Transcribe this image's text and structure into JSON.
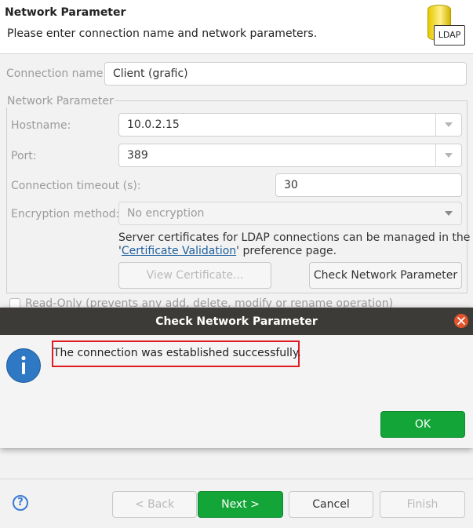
{
  "header": {
    "title": "Network Parameter",
    "subtitle": "Please enter connection name and network parameters.",
    "logo_text": "LDAP"
  },
  "connection_name": {
    "label": "Connection name:",
    "value": "Client (grafic)"
  },
  "network_group": {
    "legend": "Network Parameter",
    "hostname": {
      "label": "Hostname:",
      "value": "10.0.2.15"
    },
    "port": {
      "label": "Port:",
      "value": "389"
    },
    "timeout": {
      "label": "Connection timeout (s):",
      "value": "30"
    },
    "encryption": {
      "label": "Encryption method:",
      "value": "No encryption"
    },
    "cert_text_1": "Server certificates for LDAP connections can be managed in the",
    "cert_text_quote_open": "'",
    "cert_link": "Certificate Validation",
    "cert_text_2": "' preference page.",
    "view_cert_button": "View Certificate...",
    "check_button": "Check Network Parameter"
  },
  "readonly": {
    "label": "Read-Only (prevents any add, delete, modify or rename operation)"
  },
  "dialog": {
    "title": "Check Network Parameter",
    "message": "The connection was established successfully.",
    "ok_button": "OK",
    "icon": "info-icon"
  },
  "footer": {
    "help_icon": "?",
    "back_button": "< Back",
    "next_button": "Next >",
    "cancel_button": "Cancel",
    "finish_button": "Finish"
  },
  "colors": {
    "accent_green": "#13a538",
    "title_bar": "#3c3b37",
    "close_red": "#e2532b",
    "highlight_red": "#e01b24",
    "link_blue": "#1c5e9c"
  }
}
